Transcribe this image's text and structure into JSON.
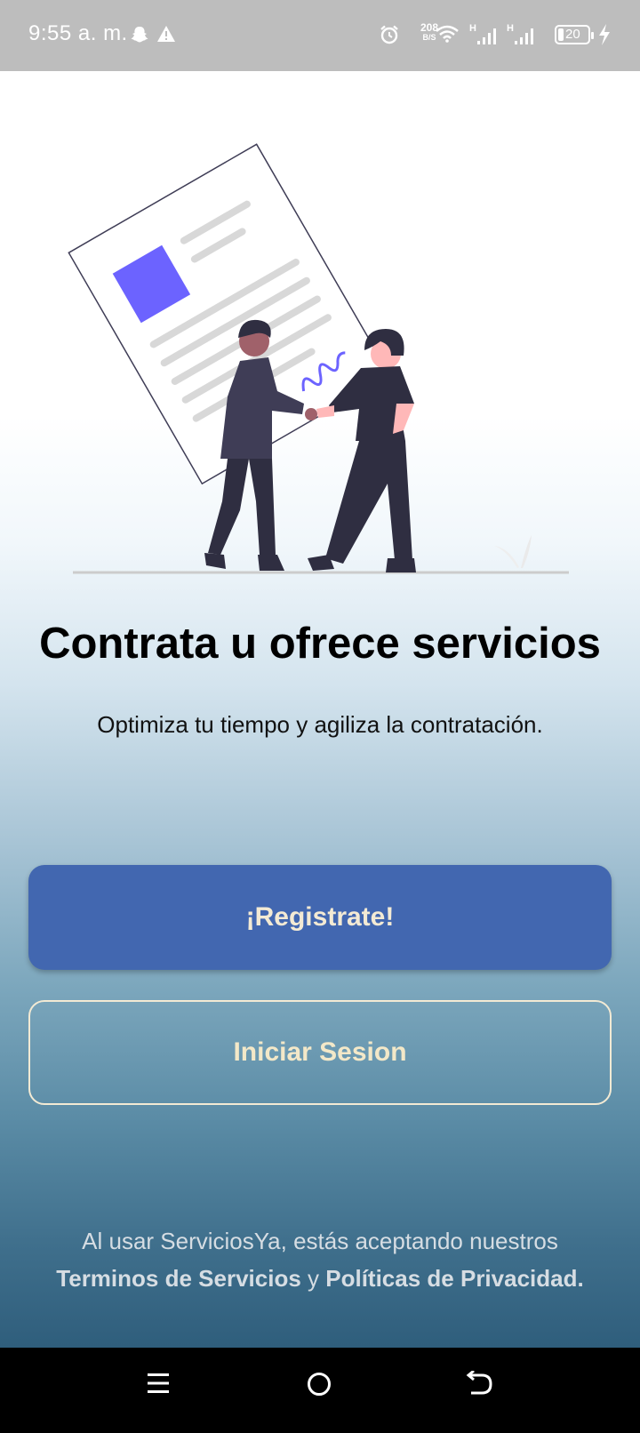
{
  "status_bar": {
    "time": "9:55 a. m.",
    "net_speed_value": "208",
    "net_speed_unit": "B/S",
    "signal_1_label": "H",
    "signal_2_label": "H",
    "battery_level": "20"
  },
  "main": {
    "headline": "Contrata u ofrece servicios",
    "subtitle": "Optimiza tu tiempo y agiliza la contratación.",
    "register_button_label": "¡Registrate!",
    "login_button_label": "Iniciar Sesion",
    "legal": {
      "line1": "Al usar ServiciosYa, estás aceptando nuestros",
      "terms_link": "Terminos de Servicios",
      "connector": " y ",
      "privacy_link": "Políticas de Privacidad",
      "end": "."
    }
  },
  "colors": {
    "status_bar_bg": "#bdbdbd",
    "primary_button": "#4267b0",
    "button_text": "#f3ead4",
    "gradient_bottom": "#2f5e7c",
    "document_accent": "#6c63ff",
    "figure_dark": "#2f2e41"
  },
  "icons": {
    "status_left": [
      "snapchat-ghost-icon",
      "warning-icon"
    ],
    "status_right": [
      "alarm-icon",
      "wifi-icon",
      "signal-icon",
      "signal-icon",
      "battery-icon",
      "charging-bolt-icon"
    ],
    "nav": [
      "recent-apps-icon",
      "home-icon",
      "back-icon"
    ]
  }
}
